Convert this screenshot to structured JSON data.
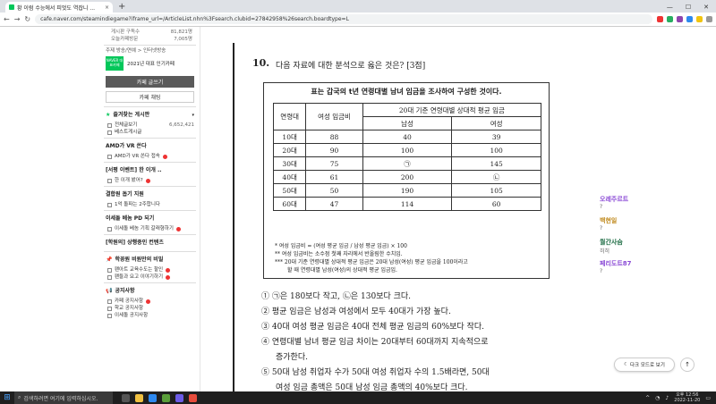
{
  "browser": {
    "tab_title": "황 이럼 수능에서 피멋도 역잡니 ...",
    "tab_close": "×",
    "new_tab": "+",
    "url": "cafe.naver.com/steamindiegame?iframe_url=/ArticleList.nhn%3Fsearch.clubid=27842958%26search.boardtype=L",
    "back": "←",
    "forward": "→",
    "reload": "↻",
    "window_buttons": [
      "—",
      "☐",
      "✕"
    ]
  },
  "sidebar": {
    "stats": [
      {
        "label": "게시판 구독수",
        "value": "81,821명"
      },
      {
        "label": "오늘카페방문",
        "value": "7,005명"
      }
    ],
    "breadcrumb": "주제 방송/연예 > 인터넷방송",
    "naver_badge": "NAVER 대표카페",
    "award": "2021년 대표 인기카페",
    "write_button": "카페 글쓰기",
    "chat_button": "카페 채팅",
    "favorites_header": "즐겨찾는 게시판",
    "favorites": [
      {
        "label": "전체글보기",
        "count": "6,652,421"
      },
      {
        "label": "베스트게시글",
        "count": ""
      }
    ],
    "sections": [
      {
        "header": "AMD가 VR 쏜다",
        "items": [
          "AMD가 VR 쏜다 접속"
        ]
      },
      {
        "header": "[서평 이벤트] 한 이개 ..",
        "items": [
          "한 이개 봤어?"
        ]
      },
      {
        "header": "결합원 돕기 지원",
        "items": [
          "1억 돌파는 2주합니다"
        ]
      },
      {
        "header": "이세돌 베놈 PD 되기",
        "items": [
          "이세돌 베놈 기획 갈래형하기"
        ]
      },
      {
        "header": "[학원의] 상행중인 컨텐츠",
        "items": []
      },
      {
        "header": "학꽁원 비원만의 비밀",
        "items": [
          "팬아트 교육수도는 할인",
          "팬들과 요고 이야기하기"
        ]
      },
      {
        "header": "공지사항",
        "items": [
          "카페 공지사항",
          "학교 공지사항",
          "이세돌 공지사항"
        ]
      }
    ]
  },
  "question": {
    "number": "10.",
    "prompt": "다음 자료에 대한 분석으로 옳은 것은? [3점]",
    "box_title": "표는 갑국의 t년 연령대별 남녀 임금을 조사하여 구성한 것이다.",
    "table_headers": {
      "age": "연령대",
      "ratio": "여성 임금비",
      "relative": "20대 기준 연령대별 상대적 평균 임금",
      "male": "남성",
      "female": "여성"
    },
    "rows": [
      [
        "10대",
        "88",
        "40",
        "39"
      ],
      [
        "20대",
        "90",
        "100",
        "100"
      ],
      [
        "30대",
        "75",
        "㉠",
        "145"
      ],
      [
        "40대",
        "61",
        "200",
        "㉡"
      ],
      [
        "50대",
        "50",
        "190",
        "105"
      ],
      [
        "60대",
        "47",
        "114",
        "60"
      ]
    ],
    "notes": [
      "* 여성 임금비 = (여성 평균 임금 / 남성 평균 임금) × 100",
      "** 여성 임금비는 소수점 첫째 자리에서 반올림한 수치임.",
      "*** 20대 기준 연령대별 상대적 평균 임금은 20대 남성(여성) 평균 임금을 100이라고",
      "할 때 연령대별 남성(여성)의 상대적 평균 임금임."
    ],
    "options": [
      "① ㉠은 180보다 작고, ㉡은 130보다 크다.",
      "② 평균 임금은 남성과 여성에서 모두 40대가 가장 높다.",
      "③ 40대 여성 평균 임금은 40대 전체 평균 임금의 60%보다 작다.",
      "④ 연령대별 남녀 평균 임금 차이는 20대부터 60대까지 지속적으로",
      "증가한다.",
      "⑤ 50대 남성 취업자 수가 50대 여성 취업자 수의 1.5배라면, 50대",
      "여성 임금 총액은 50대 남성 임금 총액의 40%보다 크다."
    ]
  },
  "comments": [
    {
      "name": "오레주르트",
      "sub": "?",
      "color": "#8b4bd6"
    },
    {
      "name": "백현일",
      "sub": "?",
      "color": "#c08a1e"
    },
    {
      "name": "월간사슴",
      "sub": "히히",
      "color": "#1c6b43"
    },
    {
      "name": "페리도트87",
      "sub": "?",
      "color": "#8b4bd6"
    }
  ],
  "floating": {
    "darkmode": "다크 모드로 보기",
    "totop": "↑"
  },
  "taskbar": {
    "search_placeholder": "검색하려면 여기에 입력하십시오.",
    "time": "오후 12:56",
    "date": "2022-11-20"
  }
}
